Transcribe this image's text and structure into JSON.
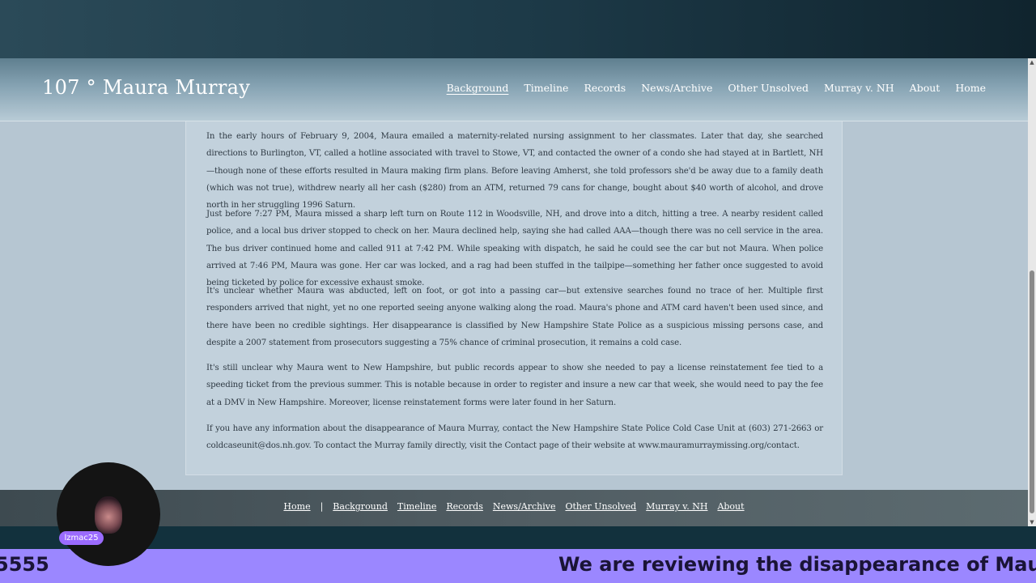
{
  "site": {
    "title": "107 ° Maura Murray"
  },
  "nav": [
    {
      "label": "Background",
      "active": true
    },
    {
      "label": "Timeline",
      "active": false
    },
    {
      "label": "Records",
      "active": false
    },
    {
      "label": "News/Archive",
      "active": false
    },
    {
      "label": "Other Unsolved",
      "active": false
    },
    {
      "label": "Murray v. NH",
      "active": false
    },
    {
      "label": "About",
      "active": false
    },
    {
      "label": "Home",
      "active": false
    }
  ],
  "content": {
    "paragraphs": [
      "In the early hours of February 9, 2004, Maura emailed a maternity-related nursing assignment to her classmates. Later that day, she searched directions to Burlington, VT, called a hotline associated with travel to Stowe, VT, and contacted the owner of a condo she had stayed at in Bartlett, NH—though none of these efforts resulted in Maura making firm plans. Before leaving Amherst, she told professors she'd be away due to a family death (which was not true), withdrew nearly all her cash ($280) from an ATM, returned 79 cans for change, bought about $40 worth of alcohol, and drove north in her struggling 1996 Saturn.",
      "Just before 7:27 PM, Maura missed a sharp left turn on Route 112 in Woodsville, NH, and drove into a ditch, hitting a tree. A nearby resident called police, and a local bus driver stopped to check on her. Maura declined help, saying she had called AAA—though there was no cell service in the area. The bus driver continued home and called 911 at 7:42 PM. While speaking with dispatch, he said he could see the car but not Maura.  When police arrived at 7:46 PM, Maura was gone. Her car was locked, and a rag had been stuffed in the tailpipe—something her father once suggested to avoid being ticketed by police for excessive exhaust smoke.",
      "It's unclear whether Maura was abducted, left on foot, or got into a passing car—but extensive searches found no trace of her. Multiple first responders arrived that night, yet no one reported seeing anyone walking along the road. Maura's phone and ATM card haven't been used since, and there have been no credible sightings. Her disappearance is classified by New Hampshire State Police as a suspicious missing persons case, and despite a 2007 statement from prosecutors suggesting a 75% chance of criminal prosecution, it remains a cold case.",
      "It's still unclear why Maura went to New Hampshire, but public records appear to show she needed to pay a license reinstatement fee tied to a speeding ticket from the previous summer. This is notable because in order to register and insure a new car that week, she would need to pay the fee at a DMV in New Hampshire. Moreover, license reinstatement forms were later found in her Saturn.",
      "If you have any information about the disappearance of Maura Murray, contact the New Hampshire State Police Cold Case Unit at (603) 271-2663 or coldcaseunit@dos.nh.gov. To contact the Murray family directly, visit the Contact page of their website at www.mauramurraymissing.org/contact."
    ]
  },
  "footer": {
    "separator": "|",
    "links": [
      "Home",
      "Background",
      "Timeline",
      "Records",
      "News/Archive",
      "Other Unsolved",
      "Murray v. NH",
      "About"
    ]
  },
  "overlay": {
    "username": "lzmac25",
    "ticker_left": "5555",
    "ticker_right": "We are reviewing the disappearance of Maura Murray"
  },
  "scrollbar": {
    "up_arrow": "▲",
    "down_arrow": "▼"
  },
  "colors": {
    "page_bg": "#b6c6d2",
    "card_bg": "#c2d1dc",
    "ticker_bg": "#9b87ff",
    "badge_bg": "#9b6bff"
  }
}
